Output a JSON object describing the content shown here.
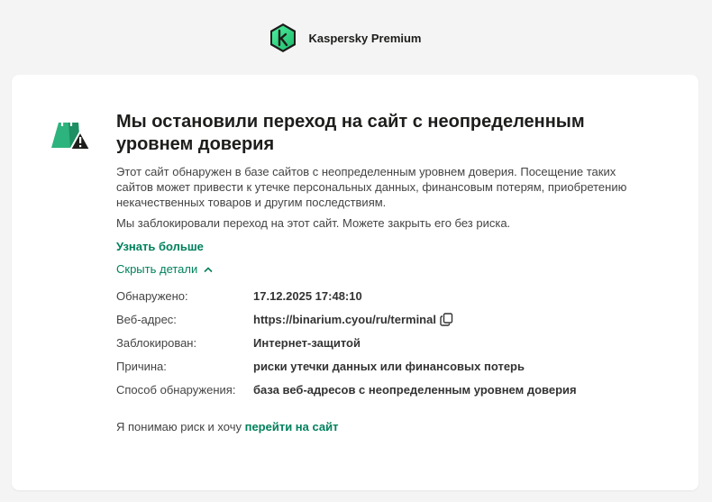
{
  "header": {
    "logo_icon": "kaspersky-k-icon",
    "product_name": "Kaspersky Premium"
  },
  "warning": {
    "icon": "shopping-bag-warning-icon",
    "title": "Мы остановили переход на сайт с неопределенным уровнем доверия",
    "description": "Этот сайт обнаружен в базе сайтов с неопределенным уровнем доверия. Посещение таких сайтов может привести к утечке персональных данных, финансовым потерям, приобретению некачественных товаров и другим последствиям.",
    "blocked_note": "Мы заблокировали переход на этот сайт. Можете закрыть его без риска.",
    "learn_more": "Узнать больше",
    "hide_details": "Скрыть детали"
  },
  "details": {
    "detected_label": "Обнаружено:",
    "detected_value": "17.12.2025 17:48:10",
    "url_label": "Веб-адрес:",
    "url_value": "https://binarium.cyou/ru/terminal",
    "blocked_by_label": "Заблокирован:",
    "blocked_by_value": "Интернет-защитой",
    "reason_label": "Причина:",
    "reason_value": "риски утечки данных или финансовых потерь",
    "method_label": "Способ обнаружения:",
    "method_value": "база веб-адресов с неопределенным уровнем доверия"
  },
  "proceed": {
    "prefix": "Я понимаю риск и хочу ",
    "link": "перейти на сайт"
  },
  "colors": {
    "accent": "#00815c",
    "logo_green": "#3ddc84",
    "background": "#f4f4f4"
  }
}
